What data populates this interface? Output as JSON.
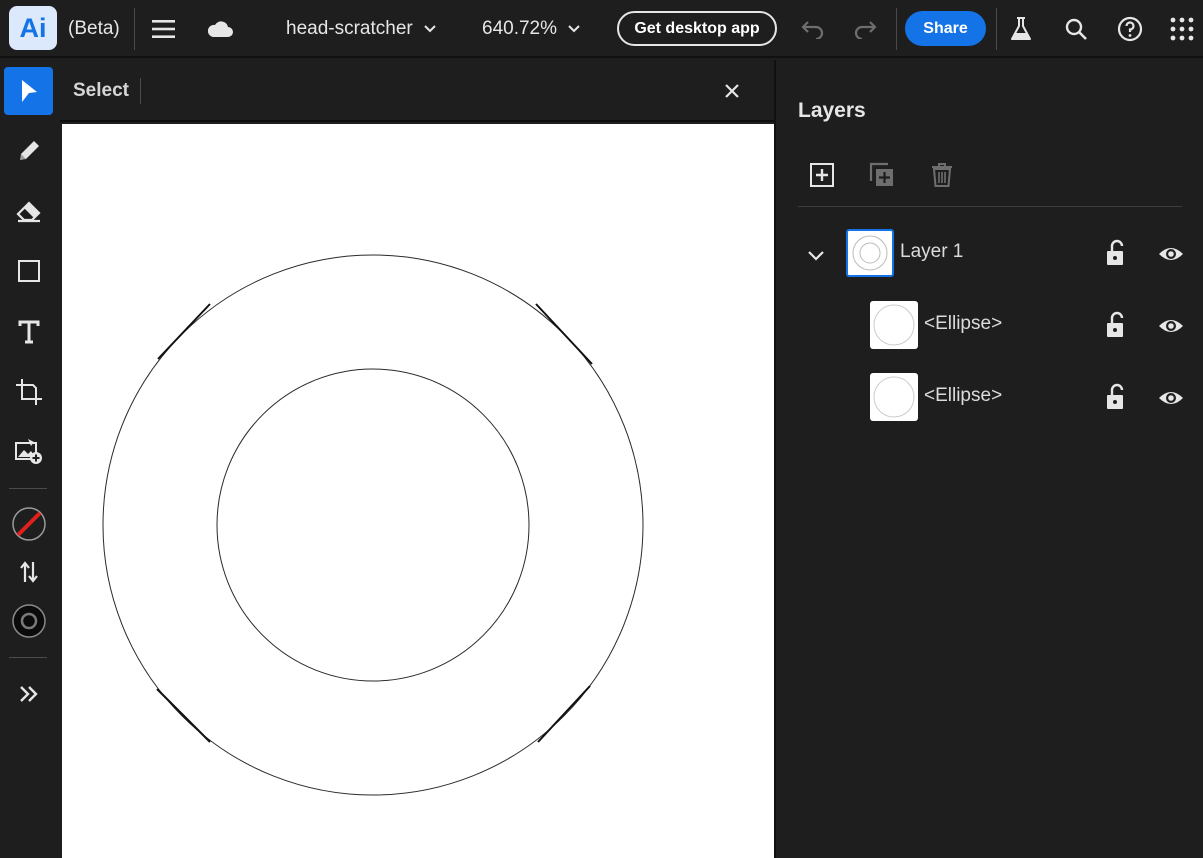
{
  "app": {
    "logo": "Ai",
    "beta_label": "(Beta)",
    "document_name": "head-scratcher",
    "zoom": "640.72%",
    "desktop_button": "Get desktop app",
    "share_button": "Share"
  },
  "toolbar": {
    "tools": [
      {
        "name": "select-tool",
        "icon": "arrow-pointer-icon",
        "active": true
      },
      {
        "name": "pencil-tool",
        "icon": "pencil-icon"
      },
      {
        "name": "eraser-tool",
        "icon": "eraser-icon"
      },
      {
        "name": "rectangle-tool",
        "icon": "rectangle-icon"
      },
      {
        "name": "type-tool",
        "icon": "type-icon"
      },
      {
        "name": "artboard-tool",
        "icon": "artboard-icon"
      },
      {
        "name": "place-image-tool",
        "icon": "place-image-icon"
      },
      {
        "name": "fill-stroke-swatch",
        "icon": "no-fill-icon"
      },
      {
        "name": "swap-fill-stroke",
        "icon": "swap-arrows-icon"
      },
      {
        "name": "stroke-swatch",
        "icon": "stroke-circle-icon"
      },
      {
        "name": "more-tools",
        "icon": "double-chevron-right-icon"
      }
    ]
  },
  "context_bar": {
    "label": "Select"
  },
  "layers_panel": {
    "title": "Layers",
    "actions": [
      {
        "name": "add-layer",
        "icon": "add-layer-icon"
      },
      {
        "name": "duplicate-layer",
        "icon": "duplicate-layer-icon"
      },
      {
        "name": "delete-layer",
        "icon": "trash-icon"
      }
    ],
    "layers": [
      {
        "name": "Layer 1",
        "expanded": true,
        "selected": true,
        "locked": false,
        "visible": true,
        "children": [
          {
            "name": "<Ellipse>",
            "locked": false,
            "visible": true
          },
          {
            "name": "<Ellipse>",
            "locked": false,
            "visible": true
          }
        ]
      }
    ]
  },
  "colors": {
    "accent": "#1473e6",
    "background": "#1e1e1e",
    "artboard": "#ffffff"
  }
}
